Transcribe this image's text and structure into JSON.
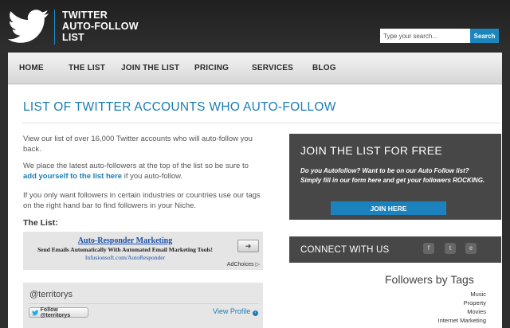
{
  "header": {
    "logo_lines": [
      "TWITTER",
      "AUTO-FOLLOW",
      "LIST"
    ],
    "search_placeholder": "Type your search...",
    "search_button": "Search"
  },
  "nav": {
    "items": [
      {
        "label": "HOME"
      },
      {
        "label": "THE LIST"
      },
      {
        "label": "JOIN THE LIST"
      },
      {
        "label": "PRICING"
      },
      {
        "label": "SERVICES"
      },
      {
        "label": "BLOG"
      }
    ]
  },
  "main": {
    "title": "LIST OF TWITTER ACCOUNTS WHO AUTO-FOLLOW",
    "intro": "View our list of over 16,000 Twitter accounts who will auto-follow you back.",
    "latest_before": "We place the latest auto-followers at the top of the list so be sure to ",
    "latest_link": "add yourself to the list here",
    "latest_after": " if you auto-follow.",
    "tags_hint": "If you only want followers in certain industries or countries use our tags on the right hand bar to find followers in your Niche.",
    "list_heading": "The List:"
  },
  "ad": {
    "title": "Auto-Responder Marketing",
    "description": "Send Emails Automatically With Automated Email Marketing Tools!",
    "url": "Infusionsoft.com/AutoResponder",
    "adchoices": "AdChoices"
  },
  "profile": {
    "handle": "@territorys",
    "follow_button": "Follow @territorys",
    "view_profile": "View Profile"
  },
  "sidebar": {
    "join_title": "JOIN THE LIST FOR FREE",
    "join_text": "Do you Autofollow? Want to be on our Auto Follow list? Simply fill in our form here and get your followers ROCKING.",
    "join_button": "JOIN HERE",
    "connect_title": "CONNECT WITH US",
    "social": [
      {
        "icon": "facebook-icon",
        "glyph": "f"
      },
      {
        "icon": "twitter-icon",
        "glyph": "t"
      },
      {
        "icon": "email-icon",
        "glyph": "e"
      }
    ],
    "tags_title": "Followers by Tags",
    "tags": [
      "Music",
      "Property",
      "Movies",
      "Internet Marketing"
    ]
  },
  "colors": {
    "accent": "#1b7db5",
    "dark_panel": "#474747",
    "header_bg": "#2e2e2e"
  }
}
